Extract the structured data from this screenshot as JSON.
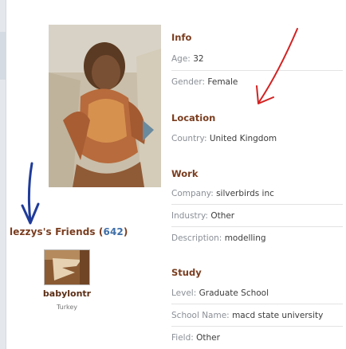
{
  "friends": {
    "title_prefix": "lezzys's Friends (",
    "count": "642",
    "title_suffix": ")",
    "items": [
      {
        "name": "babylontr",
        "country": "Turkey"
      }
    ]
  },
  "info": {
    "info_title": "Info",
    "age_label": "Age:",
    "age_value": "32",
    "gender_label": "Gender:",
    "gender_value": "Female",
    "location_title": "Location",
    "country_label": "Country:",
    "country_value": "United Kingdom",
    "work_title": "Work",
    "company_label": "Company:",
    "company_value": "silverbirds inc",
    "industry_label": "Industry:",
    "industry_value": "Other",
    "description_label": "Description:",
    "description_value": "modelling",
    "study_title": "Study",
    "level_label": "Level:",
    "level_value": "Graduate School",
    "school_label": "School Name:",
    "school_value": "macd state university",
    "field_label": "Field:",
    "field_value": "Other"
  },
  "annotations": {
    "arrow_color": "#1f3b9a",
    "arrow2_color": "#d42121"
  }
}
